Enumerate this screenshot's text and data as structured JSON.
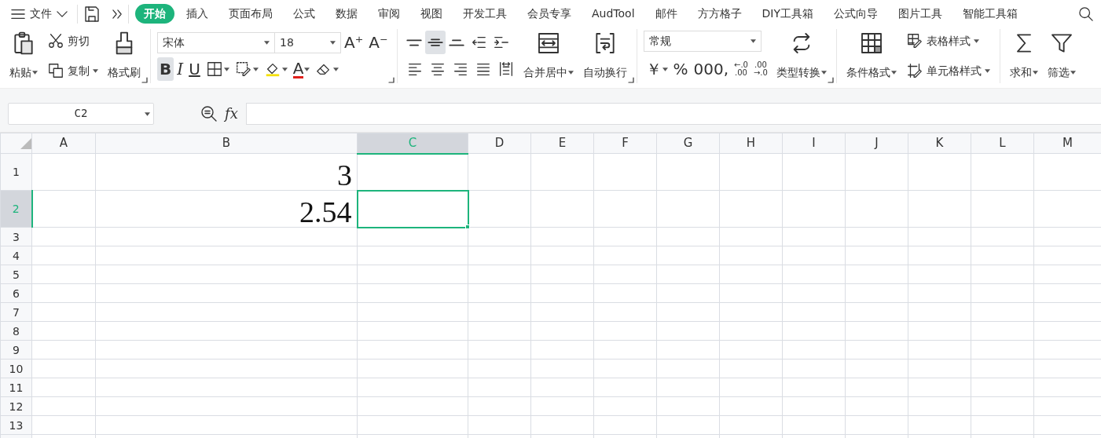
{
  "menu": {
    "label": "文件"
  },
  "tabs": [
    {
      "label": "开始",
      "selected": true
    },
    {
      "label": "插入",
      "selected": false
    },
    {
      "label": "页面布局",
      "selected": false
    },
    {
      "label": "公式",
      "selected": false
    },
    {
      "label": "数据",
      "selected": false
    },
    {
      "label": "审阅",
      "selected": false
    },
    {
      "label": "视图",
      "selected": false
    },
    {
      "label": "开发工具",
      "selected": false
    },
    {
      "label": "会员专享",
      "selected": false
    },
    {
      "label": "AudTool",
      "selected": false
    },
    {
      "label": "邮件",
      "selected": false
    },
    {
      "label": "方方格子",
      "selected": false
    },
    {
      "label": "DIY工具箱",
      "selected": false
    },
    {
      "label": "公式向导",
      "selected": false
    },
    {
      "label": "图片工具",
      "selected": false
    },
    {
      "label": "智能工具箱",
      "selected": false
    }
  ],
  "ribbon_groups": [
    {
      "launcher": true,
      "columns": [
        {
          "kind": "large",
          "label": "粘贴",
          "dropdown": true
        },
        {
          "kind": "stack",
          "top": [
            {
              "kind": "small",
              "label": "剪切",
              "dropdown": false
            }
          ],
          "bottom": [
            {
              "kind": "small",
              "label": "复制",
              "dropdown": true
            }
          ]
        },
        {
          "kind": "large",
          "label": "格式刷",
          "dropdown": false
        }
      ]
    },
    {
      "launcher": true,
      "columns": [
        {
          "kind": "stack",
          "top": [
            {
              "kind": "select",
              "value": "宋体"
            },
            {
              "kind": "select",
              "value": "18"
            },
            {
              "kind": "glyph",
              "text": "A⁺",
              "dropdown": false,
              "selected": false
            },
            {
              "kind": "glyph",
              "text": "A⁻",
              "dropdown": false,
              "selected": false
            }
          ],
          "bottom": [
            {
              "kind": "bold",
              "text": "B",
              "dropdown": false,
              "selected": true
            },
            {
              "kind": "italic",
              "text": "I",
              "dropdown": false,
              "selected": false
            },
            {
              "kind": "underline",
              "text": "U",
              "dropdown": false,
              "selected": false
            },
            {
              "kind": "icon",
              "dropdown": true,
              "selected": false
            },
            {
              "kind": "icon",
              "dropdown": true,
              "selected": false
            },
            {
              "kind": "icon",
              "dropdown": true,
              "selected": false
            },
            {
              "kind": "fontcolor",
              "text": "A",
              "dropdown": true,
              "selected": false
            },
            {
              "kind": "icon",
              "dropdown": true,
              "selected": false
            }
          ]
        }
      ]
    },
    {
      "launcher": true,
      "columns": [
        {
          "kind": "stack",
          "top": [
            {
              "kind": "icon",
              "dropdown": false,
              "selected": false
            },
            {
              "kind": "icon",
              "dropdown": false,
              "selected": true
            },
            {
              "kind": "icon",
              "dropdown": false,
              "selected": false
            },
            {
              "kind": "icon",
              "dropdown": false,
              "selected": false
            },
            {
              "kind": "icon",
              "dropdown": false,
              "selected": false
            }
          ],
          "bottom": [
            {
              "kind": "icon",
              "dropdown": false,
              "selected": false
            },
            {
              "kind": "icon",
              "dropdown": false,
              "selected": false
            },
            {
              "kind": "icon",
              "dropdown": false,
              "selected": false
            },
            {
              "kind": "icon",
              "dropdown": false,
              "selected": false
            },
            {
              "kind": "icon",
              "dropdown": false,
              "selected": false
            }
          ]
        },
        {
          "kind": "large",
          "label": "合并居中",
          "dropdown": true
        },
        {
          "kind": "large",
          "label": "自动换行",
          "dropdown": false
        }
      ]
    },
    {
      "launcher": true,
      "columns": [
        {
          "kind": "stack",
          "top": [
            {
              "kind": "select",
              "value": "常规"
            }
          ],
          "bottom": [
            {
              "kind": "glyph",
              "text": "￥",
              "dropdown": true,
              "selected": false
            },
            {
              "kind": "glyph",
              "text": "%",
              "dropdown": false,
              "selected": false
            },
            {
              "kind": "glyph",
              "text": "000,",
              "dropdown": false,
              "selected": false
            },
            {
              "kind": "twoline",
              "lines": [
                "←.0",
                ".00"
              ],
              "dropdown": false,
              "selected": false
            },
            {
              "kind": "twoline",
              "lines": [
                ".00",
                "→.0"
              ],
              "dropdown": false,
              "selected": false
            }
          ]
        },
        {
          "kind": "large",
          "label": "类型转换",
          "dropdown": true
        }
      ]
    },
    {
      "launcher": false,
      "columns": [
        {
          "kind": "large",
          "label": "条件格式",
          "dropdown": true
        },
        {
          "kind": "stack",
          "top": [
            {
              "kind": "small",
              "label": "表格样式",
              "dropdown": true
            }
          ],
          "bottom": [
            {
              "kind": "small",
              "label": "单元格样式",
              "dropdown": true
            }
          ]
        }
      ]
    },
    {
      "launcher": false,
      "columns": [
        {
          "kind": "large",
          "label": "求和",
          "dropdown": true
        },
        {
          "kind": "large",
          "label": "筛选",
          "dropdown": true
        }
      ]
    }
  ],
  "formula_bar": {
    "name_box": "C2",
    "function_label": "fx"
  },
  "sheet": {
    "columns": [
      {
        "label": "A",
        "selected": false
      },
      {
        "label": "B",
        "selected": false
      },
      {
        "label": "C",
        "selected": true
      },
      {
        "label": "D",
        "selected": false
      },
      {
        "label": "E",
        "selected": false
      },
      {
        "label": "F",
        "selected": false
      },
      {
        "label": "G",
        "selected": false
      },
      {
        "label": "H",
        "selected": false
      },
      {
        "label": "I",
        "selected": false
      },
      {
        "label": "J",
        "selected": false
      },
      {
        "label": "K",
        "selected": false
      },
      {
        "label": "L",
        "selected": false
      },
      {
        "label": "M",
        "selected": false
      }
    ],
    "rows": [
      {
        "label": "1",
        "selected": false,
        "cells": [
          {
            "selected": false
          },
          {
            "text": "3",
            "selected": false
          },
          {
            "selected": false
          }
        ]
      },
      {
        "label": "2",
        "selected": true,
        "cells": [
          {
            "selected": false
          },
          {
            "text": "2.54",
            "selected": false
          },
          {
            "selected": true
          }
        ]
      },
      {
        "label": "3",
        "selected": false
      },
      {
        "label": "4",
        "selected": false
      },
      {
        "label": "5",
        "selected": false
      },
      {
        "label": "6",
        "selected": false
      },
      {
        "label": "7",
        "selected": false
      },
      {
        "label": "8",
        "selected": false
      },
      {
        "label": "9",
        "selected": false
      },
      {
        "label": "10",
        "selected": false
      },
      {
        "label": "11",
        "selected": false
      },
      {
        "label": "12",
        "selected": false
      },
      {
        "label": "13",
        "selected": false
      }
    ]
  }
}
